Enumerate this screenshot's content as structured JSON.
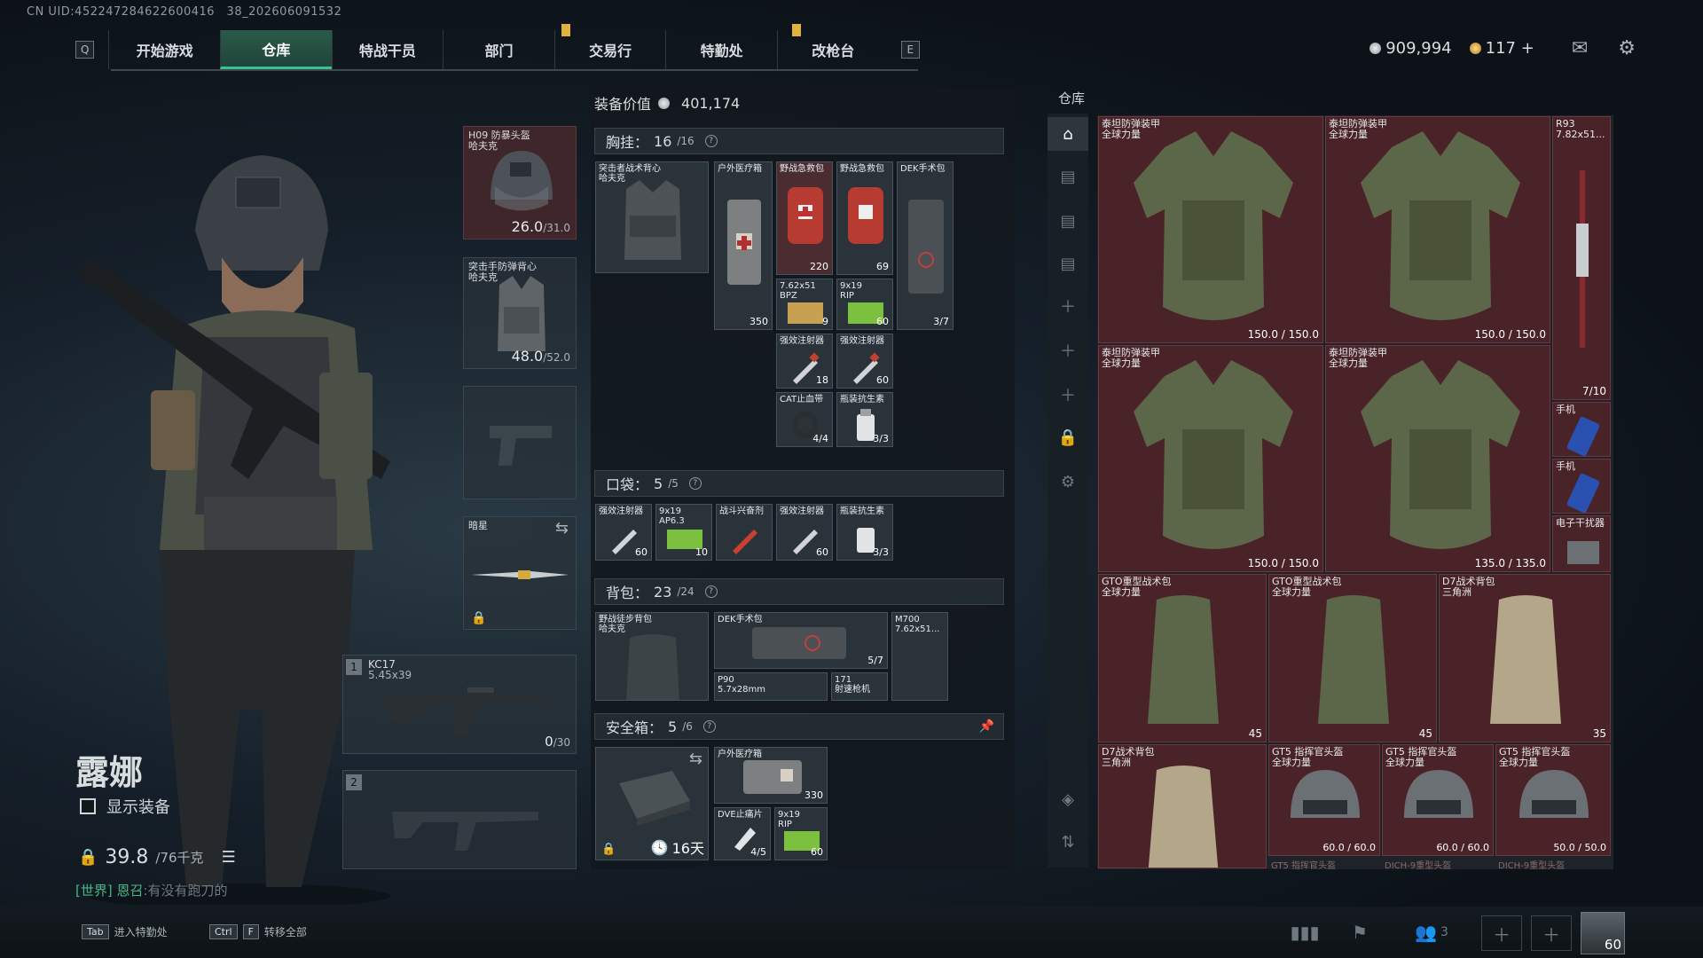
{
  "uid": "CN UID:452247284622600416 38_202606091532",
  "nav": {
    "left_key": "Q",
    "right_key": "E",
    "tabs": [
      "开始游戏",
      "仓库",
      "特战干员",
      "部门",
      "交易行",
      "特勤处",
      "改枪台"
    ],
    "active_tab": "仓库"
  },
  "currency": {
    "silver": "909,994",
    "gold": "117",
    "plus": "+"
  },
  "character": {
    "name": "露娜",
    "show_equipment": "显示装备",
    "weight": "39.8",
    "weight_max": "/76千克"
  },
  "chat": {
    "channel": "[世界] 恩召",
    "text": ":有没有跑刀的"
  },
  "equipment": {
    "helmet": {
      "label": "H09 防暴头盔",
      "sub": "哈夫克",
      "value": "26.0",
      "max": "/31.0"
    },
    "armor": {
      "label": "突击手防弹背心",
      "sub": "哈夫克",
      "value": "48.0",
      "max": "/52.0"
    },
    "melee": {
      "label": "暗星"
    },
    "primary": {
      "slot": "1",
      "label": "KC17",
      "caliber": "5.45x39",
      "ammo": "0",
      "ammo_max": "/30"
    },
    "secondary": {
      "slot": "2"
    }
  },
  "gear_value": {
    "label": "装备价值",
    "value": "401,174"
  },
  "chest": {
    "label": "胸挂：",
    "count": "16",
    "max": "/16"
  },
  "pocket": {
    "label": "口袋：",
    "count": "5",
    "max": "/5"
  },
  "backpack": {
    "label": "背包：",
    "count": "23",
    "max": "/24"
  },
  "safebox": {
    "label": "安全箱：",
    "count": "5",
    "max": "/6",
    "timer": "16天"
  },
  "chest_items": [
    {
      "name": "突击者战术背心",
      "sub": "哈夫克",
      "val": ""
    },
    {
      "name": "户外医疗箱",
      "val": "350"
    },
    {
      "name": "野战急救包",
      "val": "220"
    },
    {
      "name": "野战急救包",
      "val": "69"
    },
    {
      "name": "DEK手术包",
      "val": "3/7"
    },
    {
      "name": "7.62x51",
      "sub": "BPZ",
      "val": "9"
    },
    {
      "name": "9x19",
      "sub": "RIP",
      "val": "60"
    },
    {
      "name": "强效注射器",
      "val": "18"
    },
    {
      "name": "强效注射器",
      "val": "60"
    },
    {
      "name": "CAT止血带",
      "val": "4/4"
    },
    {
      "name": "瓶装抗生素",
      "val": "3/3"
    }
  ],
  "pocket_items": [
    {
      "name": "强效注射器",
      "val": "60"
    },
    {
      "name": "9x19",
      "sub": "AP6.3",
      "val": "10"
    },
    {
      "name": "战斗兴奋剂",
      "val": ""
    },
    {
      "name": "强效注射器",
      "val": "60"
    },
    {
      "name": "瓶装抗生素",
      "val": "3/3"
    }
  ],
  "backpack_items": [
    {
      "name": "野战徒步背包",
      "sub": "哈夫克",
      "val": ""
    },
    {
      "name": "DEK手术包",
      "val": "5/7"
    },
    {
      "name": "M700",
      "sub": "7.62x51...",
      "val": ""
    },
    {
      "name": "P90",
      "sub": "5.7x28mm",
      "val": ""
    },
    {
      "name": "171",
      "sub": "射速枪机",
      "val": ""
    }
  ],
  "safebox_items": [
    {
      "name": "户外医疗箱",
      "val": "330"
    },
    {
      "name": "DVE止痛片",
      "val": "4/5"
    },
    {
      "name": "9x19",
      "sub": "RIP",
      "val": "60"
    }
  ],
  "warehouse": {
    "title": "仓库",
    "items": [
      {
        "name": "泰坦防弹装甲",
        "sub": "全球力量",
        "val": "150.0 / 150.0"
      },
      {
        "name": "泰坦防弹装甲",
        "sub": "全球力量",
        "val": "150.0 / 150.0"
      },
      {
        "name": "R93",
        "sub": "7.82x51...",
        "val": "7/10"
      },
      {
        "name": "泰坦防弹装甲",
        "sub": "全球力量",
        "val": "150.0 / 150.0"
      },
      {
        "name": "泰坦防弹装甲",
        "sub": "全球力量",
        "val": "135.0 / 135.0"
      },
      {
        "name": "手机",
        "val": ""
      },
      {
        "name": "手机",
        "val": ""
      },
      {
        "name": "电子干扰器",
        "val": ""
      },
      {
        "name": "GTO重型战术包",
        "sub": "全球力量",
        "val": "45"
      },
      {
        "name": "GTO重型战术包",
        "sub": "全球力量",
        "val": "45"
      },
      {
        "name": "D7战术背包",
        "sub": "三角洲",
        "val": "35"
      },
      {
        "name": "D7战术背包",
        "sub": "三角洲",
        "val": ""
      },
      {
        "name": "GT5 指挥官头盔",
        "sub": "全球力量",
        "val": "60.0 / 60.0"
      },
      {
        "name": "GT5 指挥官头盔",
        "sub": "全球力量",
        "val": "60.0 / 60.0"
      },
      {
        "name": "GT5 指挥官头盔",
        "sub": "全球力量",
        "val": "50.0 / 50.0"
      }
    ],
    "footer": [
      "GT5 指挥官头盔",
      "DICH-9重型头盔",
      "DICH-9重型头盔"
    ]
  },
  "bottom": {
    "tab_key": "Tab",
    "tab_label": "进入特勤处",
    "ctrl_key": "Ctrl",
    "f_key": "F",
    "f_label": "转移全部",
    "squad_count": "3",
    "level": "60"
  }
}
